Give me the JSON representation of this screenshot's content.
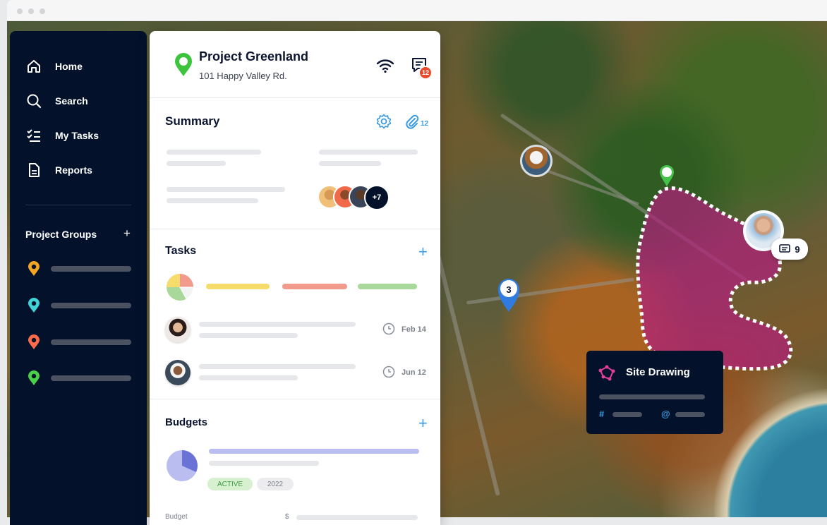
{
  "sidebar": {
    "items": [
      {
        "label": "Home",
        "icon": "home-icon"
      },
      {
        "label": "Search",
        "icon": "search-icon"
      },
      {
        "label": "My Tasks",
        "icon": "tasks-icon"
      },
      {
        "label": "Reports",
        "icon": "reports-icon"
      }
    ],
    "groups_title": "Project Groups",
    "groups_add": "+",
    "groups": [
      {
        "color": "#f5a623"
      },
      {
        "color": "#3fd4d9"
      },
      {
        "color": "#ff6b4a"
      },
      {
        "color": "#4cd04a"
      }
    ]
  },
  "project": {
    "title": "Project Greenland",
    "address": "101 Happy Valley Rd.",
    "message_count": "12",
    "pin_color": "#3cc43c"
  },
  "summary": {
    "title": "Summary",
    "attachment_count": "12",
    "extra_members": "+7"
  },
  "tasks": {
    "title": "Tasks",
    "add": "+",
    "items": [
      {
        "date": "Feb 14"
      },
      {
        "date": "Jun 12"
      }
    ],
    "status_colors": [
      "#f6dd6b",
      "#f29a8c",
      "#a8d99a"
    ]
  },
  "budgets": {
    "title": "Budgets",
    "add": "+",
    "status_badge": "ACTIVE",
    "year_badge": "2022",
    "footer_label": "Budget",
    "footer_currency": "$"
  },
  "map": {
    "marker_count": "3",
    "comment_count": "9",
    "site_card": {
      "title": "Site Drawing",
      "hash_symbol": "#",
      "at_symbol": "@"
    },
    "zone_color": "#b0207a"
  }
}
